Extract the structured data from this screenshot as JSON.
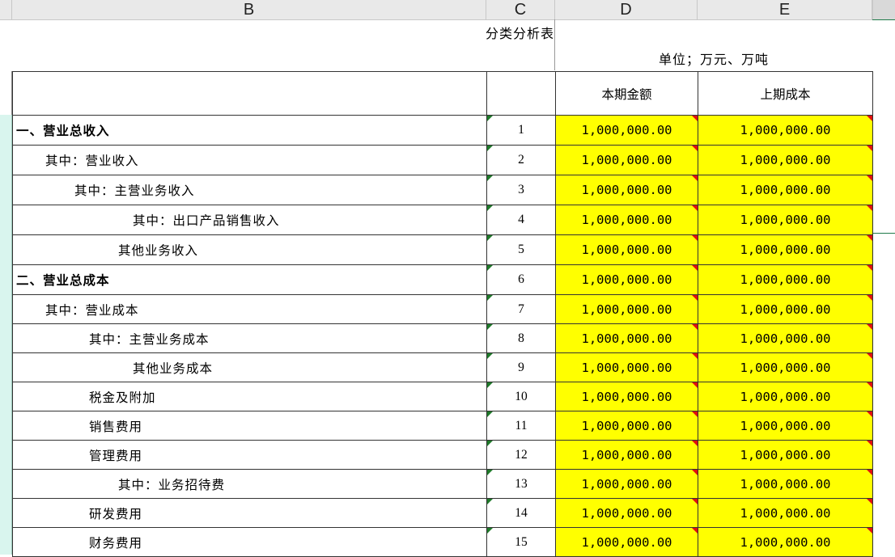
{
  "columns": [
    {
      "id": "B",
      "label": "B"
    },
    {
      "id": "C",
      "label": "C"
    },
    {
      "id": "D",
      "label": "D"
    },
    {
      "id": "E",
      "label": "E"
    }
  ],
  "sheet": {
    "title": "分类分析表",
    "unit": "单位；万元、万吨",
    "header": {
      "current_amount": "本期金额",
      "prior_cost": "上期成本"
    },
    "rows": [
      {
        "label": "一、营业总收入",
        "indent": 0,
        "bold": true,
        "no": "1",
        "d": "1,000,000.00",
        "e": "1,000,000.00"
      },
      {
        "label": "其中：营业收入",
        "indent": 1,
        "bold": false,
        "no": "2",
        "d": "1,000,000.00",
        "e": "1,000,000.00"
      },
      {
        "label": "其中：主营业务收入",
        "indent": 2,
        "bold": false,
        "no": "3",
        "d": "1,000,000.00",
        "e": "1,000,000.00"
      },
      {
        "label": "其中：出口产品销售收入",
        "indent": 4,
        "bold": false,
        "no": "4",
        "d": "1,000,000.00",
        "e": "1,000,000.00"
      },
      {
        "label": "其他业务收入",
        "indent": 3.5,
        "bold": false,
        "no": "5",
        "d": "1,000,000.00",
        "e": "1,000,000.00"
      },
      {
        "label": "二、营业总成本",
        "indent": 0,
        "bold": true,
        "no": "6",
        "d": "1,000,000.00",
        "e": "1,000,000.00"
      },
      {
        "label": "其中：营业成本",
        "indent": 1,
        "bold": false,
        "no": "7",
        "d": "1,000,000.00",
        "e": "1,000,000.00"
      },
      {
        "label": "其中：主营业务成本",
        "indent": 2.5,
        "bold": false,
        "no": "8",
        "d": "1,000,000.00",
        "e": "1,000,000.00"
      },
      {
        "label": "其他业务成本",
        "indent": 4,
        "bold": false,
        "no": "9",
        "d": "1,000,000.00",
        "e": "1,000,000.00"
      },
      {
        "label": "税金及附加",
        "indent": 2.5,
        "bold": false,
        "no": "10",
        "d": "1,000,000.00",
        "e": "1,000,000.00"
      },
      {
        "label": "销售费用",
        "indent": 2.5,
        "bold": false,
        "no": "11",
        "d": "1,000,000.00",
        "e": "1,000,000.00"
      },
      {
        "label": "管理费用",
        "indent": 2.5,
        "bold": false,
        "no": "12",
        "d": "1,000,000.00",
        "e": "1,000,000.00"
      },
      {
        "label": "其中：业务招待费",
        "indent": 3.5,
        "bold": false,
        "no": "13",
        "d": "1,000,000.00",
        "e": "1,000,000.00"
      },
      {
        "label": "研发费用",
        "indent": 2.5,
        "bold": false,
        "no": "14",
        "d": "1,000,000.00",
        "e": "1,000,000.00"
      },
      {
        "label": "财务费用",
        "indent": 2.5,
        "bold": false,
        "no": "15",
        "d": "1,000,000.00",
        "e": "1,000,000.00"
      }
    ]
  },
  "colors": {
    "cell_fill": "#ffff00",
    "comment_marker": "#e01010",
    "error_marker": "#1f7a2a"
  }
}
